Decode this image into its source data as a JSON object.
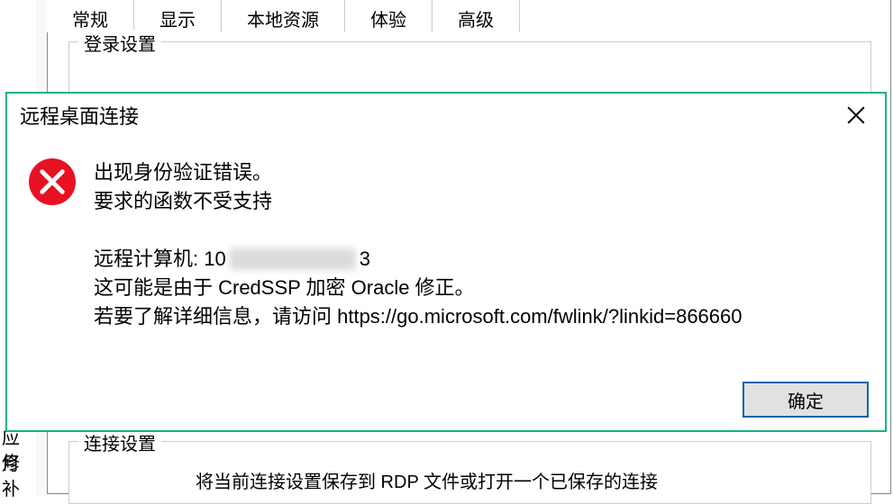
{
  "background": {
    "tabs": [
      "常规",
      "显示",
      "本地资源",
      "体验",
      "高级"
    ],
    "active_tab": 0,
    "login_group_label": "登录设置",
    "conn_group_label": "连接设置",
    "conn_group_hint": "将当前连接设置保存到 RDP 文件或打开一个已保存的连接",
    "left_labels": {
      "a": "应月",
      "b": "修补"
    }
  },
  "dialog": {
    "title": "远程桌面连接",
    "close_icon": "close-icon",
    "error_icon": "error-x-icon",
    "msg": {
      "line1": "出现身份验证错误。",
      "line2": "要求的函数不受支持",
      "remote_prefix": "远程计算机: 10",
      "remote_suffix": "3",
      "line4": "这可能是由于 CredSSP 加密 Oracle 修正。",
      "line5": "若要了解详细信息，请访问 https://go.microsoft.com/fwlink/?linkid=866660"
    },
    "ok_label": "确定"
  }
}
